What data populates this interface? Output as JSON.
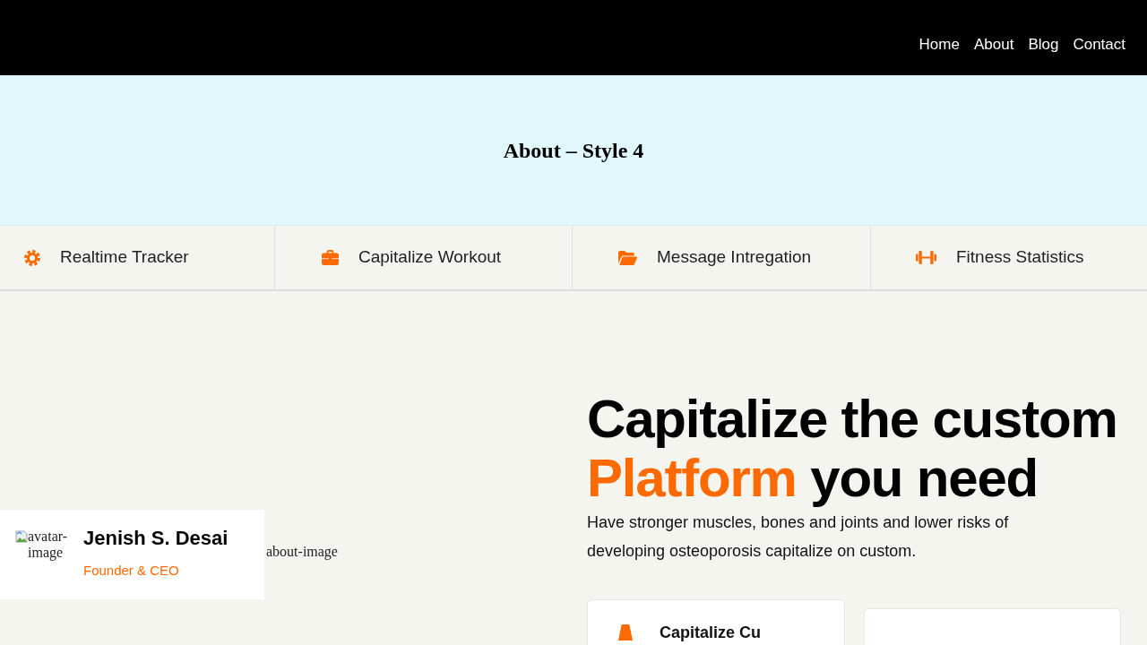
{
  "nav_links": [
    {
      "label": "Home"
    },
    {
      "label": "About"
    },
    {
      "label": "Blog"
    },
    {
      "label": "Contact"
    }
  ],
  "banner": {
    "title": "About – Style 4"
  },
  "features": [
    {
      "kind": "gear",
      "label": "Realtime Tracker"
    },
    {
      "kind": "briefcase",
      "label": "Capitalize Workout"
    },
    {
      "kind": "folder",
      "label": "Message Intregation"
    },
    {
      "kind": "dumbbell",
      "label": "Fitness Statistics"
    }
  ],
  "profile_card": {
    "avatar_alt": "avatar-image",
    "name": "Jenish S. Desai",
    "role": "Founder & CEO"
  },
  "about_image": {
    "alt": "about-image"
  },
  "hero": {
    "heading_before": "Capitalize the custom",
    "heading_highlight": "Platform",
    "heading_after": "you need",
    "text": "Have stronger muscles, bones and joints and lower risks of developing osteoporosis capitalize on custom."
  },
  "cards": [
    {
      "kind": "titled",
      "title": "Capitalize Cu"
    },
    {
      "kind": "blank"
    }
  ]
}
